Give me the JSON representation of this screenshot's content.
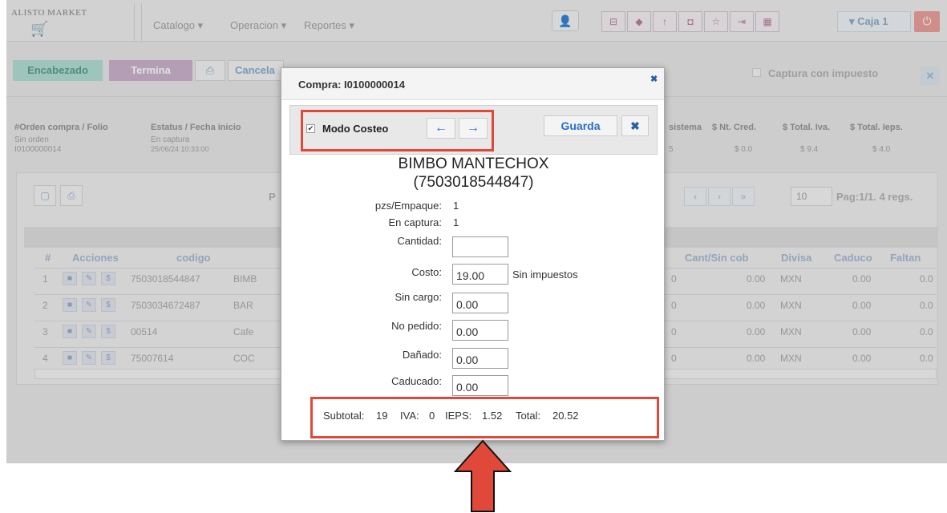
{
  "navbar": {
    "logo_text": "ALISTO MARKET",
    "logo_icon": "cart-icon",
    "menu": [
      "Catalogo ▾",
      "Operacion ▾",
      "Reportes ▾"
    ],
    "caja": "▾  Caja 1",
    "toolbar_icons": [
      "cart-icon",
      "cube-icon",
      "upload-icon",
      "shield-icon",
      "star-icon",
      "login-icon",
      "grid-icon"
    ]
  },
  "toolbar": {
    "encabezado": "Encabezado",
    "termina": "Termina",
    "cancela": "Cancela",
    "captura": "Captura con impuesto"
  },
  "info": {
    "headers": [
      "#Orden compra / Folio",
      "Estatus / Fecha inicio",
      "sistema",
      "$ Nt. Cred.",
      "$ Total. Iva.",
      "$ Total. Ieps."
    ],
    "order": "Sin orden",
    "folio": "I0100000014",
    "status": "En captura",
    "date": "25/06/24 10:33:00",
    "sistema": "5",
    "nt_cred": "$ 0.0",
    "total_iva": "$ 9.4",
    "total_ieps": "$ 4.0"
  },
  "grid": {
    "pag_size": "10",
    "pag_info": "Pag:1/1. 4 regs.",
    "pag_p": "P",
    "headers": [
      "#",
      "Acciones",
      "codigo",
      "Cant/Sin cob",
      "Divisa",
      "Caduco",
      "Faltan"
    ],
    "rows": [
      {
        "n": "1",
        "codigo": "7503018544847",
        "desc": "BIMB",
        "a": "0",
        "cant": "0.00",
        "divisa": "MXN",
        "caduco": "0.00",
        "faltan": "0.0"
      },
      {
        "n": "2",
        "codigo": "7503034672487",
        "desc": "BAR",
        "a": "0",
        "cant": "0.00",
        "divisa": "MXN",
        "caduco": "0.00",
        "faltan": "0.0"
      },
      {
        "n": "3",
        "codigo": "00514",
        "desc": "Cafe",
        "a": "0",
        "cant": "0.00",
        "divisa": "MXN",
        "caduco": "0.00",
        "faltan": "0.0"
      },
      {
        "n": "4",
        "codigo": "75007614",
        "desc": "COC",
        "a": "0",
        "cant": "0.00",
        "divisa": "MXN",
        "caduco": "0.00",
        "faltan": "0.0"
      }
    ]
  },
  "modal": {
    "title": "Compra: I0100000014",
    "modo_costeo": "Modo Costeo",
    "guarda": "Guarda",
    "product_name": "BIMBO MANTECHOX",
    "product_code": "(7503018544847)",
    "pzs_label": "pzs/Empaque:",
    "pzs_value": "1",
    "captura_label": "En captura:",
    "captura_value": "1",
    "cantidad_label": "Cantidad:",
    "cantidad_value": "",
    "costo_label": "Costo:",
    "costo_value": "19.00",
    "costo_note": "Sin impuestos",
    "sin_cargo_label": "Sin cargo:",
    "sin_cargo_value": "0.00",
    "no_pedido_label": "No pedido:",
    "no_pedido_value": "0.00",
    "danado_label": "Dañado:",
    "danado_value": "0.00",
    "caducado_label": "Caducado:",
    "caducado_value": "0.00",
    "subtotal_label": "Subtotal:",
    "subtotal": "19",
    "iva_label": "IVA:",
    "iva": "0",
    "ieps_label": "IEPS:",
    "ieps": "1.52",
    "total_label": "Total:",
    "total": "20.52"
  },
  "colors": {
    "annotation": "#e0493a",
    "accent": "#2a6fc8"
  }
}
